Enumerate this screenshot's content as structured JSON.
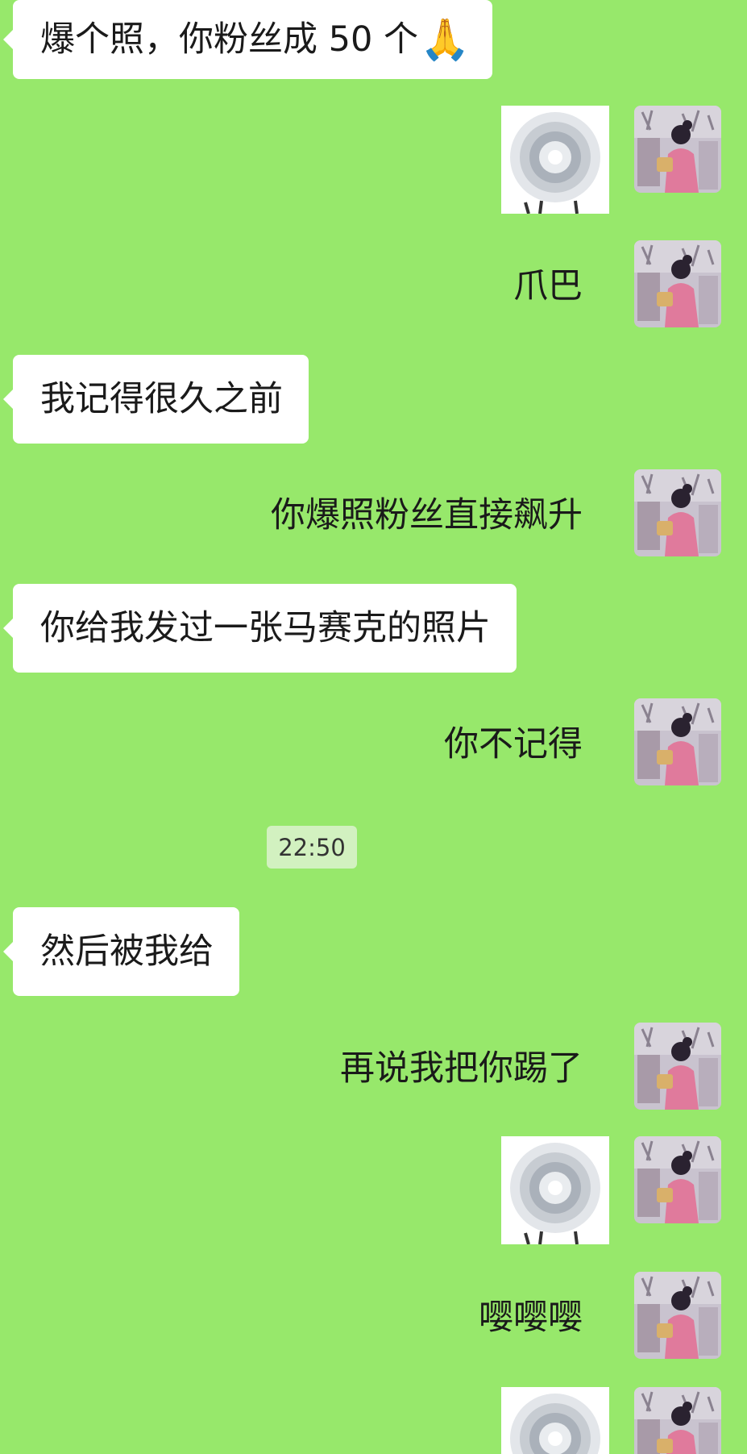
{
  "messages": {
    "m1": "爆个照，你粉丝成 50 个",
    "m1_emoji": "🙏",
    "m3": "爪巴",
    "m4": "我记得很久之前",
    "m5": "你爆照粉丝直接飙升",
    "m6": "你给我发过一张马赛克的照片",
    "m7": "你不记得",
    "m8": "然后被我给",
    "m9": "再说我把你踢了",
    "m11": "嘤嘤嘤"
  },
  "timestamp": "22:50",
  "icons": {
    "avatar": "avatar-girl-pink-coat",
    "sticker": "sticker-spiral-eye",
    "emoji": "folded-hands-emoji"
  },
  "colors": {
    "background": "#97e86b",
    "bubble": "#ffffff",
    "timestamp_bg": "#d2f1c0"
  }
}
